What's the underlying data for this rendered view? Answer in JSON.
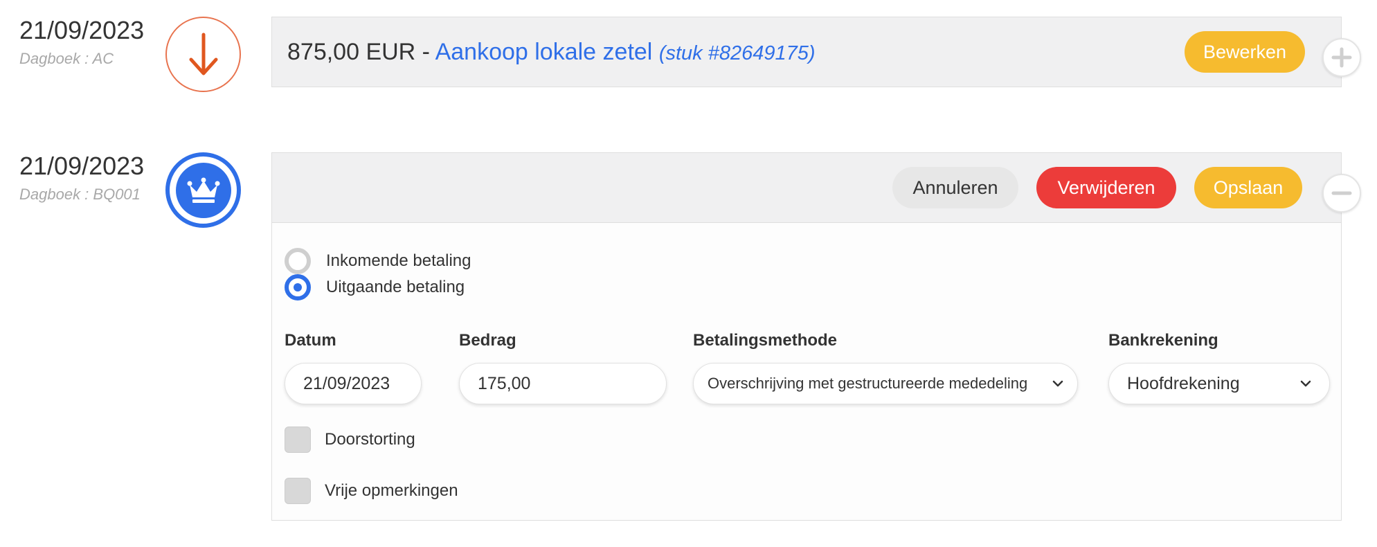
{
  "entries": [
    {
      "date": "21/09/2023",
      "journal": "Dagboek : AC",
      "icon": "arrow-down-icon",
      "amount": "875,00 EUR",
      "separator": " - ",
      "description": "Aankoop lokale zetel",
      "reference": "(stuk #82649175)",
      "edit_label": "Bewerken",
      "toggle": "plus-icon"
    },
    {
      "date": "21/09/2023",
      "journal": "Dagboek : BQ001",
      "icon": "crown-icon",
      "cancel_label": "Annuleren",
      "delete_label": "Verwijderen",
      "save_label": "Opslaan",
      "toggle": "minus-icon",
      "form": {
        "radio_incoming": "Inkomende betaling",
        "radio_outgoing": "Uitgaande betaling",
        "selected_radio": "outgoing",
        "date_label": "Datum",
        "date_value": "21/09/2023",
        "amount_label": "Bedrag",
        "amount_value": "175,00",
        "method_label": "Betalingsmethode",
        "method_value": "Overschrijving met gestructureerde mededeling",
        "bank_label": "Bankrekening",
        "bank_value": "Hoofdrekening",
        "check_transfer": "Doorstorting",
        "check_remarks": "Vrije opmerkingen"
      }
    }
  ],
  "colors": {
    "accent_blue": "#2f6fe8",
    "warning_yellow": "#f6bb2f",
    "danger_red": "#ec3c3a",
    "purchase_orange": "#e8734e"
  }
}
